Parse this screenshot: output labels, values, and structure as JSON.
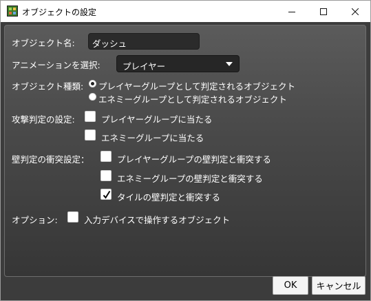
{
  "window": {
    "title": "オブジェクトの設定",
    "minimize_glyph": "─",
    "maximize_glyph": "☐",
    "close_glyph": "✕"
  },
  "object_name": {
    "label": "オブジェクト名:",
    "value": "ダッシュ"
  },
  "animation": {
    "label": "アニメーションを選択:",
    "selected": "プレイヤー"
  },
  "object_type": {
    "label": "オブジェクト種類:",
    "options": [
      {
        "label": "プレイヤーグループとして判定されるオブジェクト",
        "selected": true
      },
      {
        "label": "エネミーグループとして判定されるオブジェクト",
        "selected": false
      }
    ]
  },
  "attack": {
    "label": "攻撃判定の設定:",
    "options": [
      {
        "label": "プレイヤーグループに当たる",
        "checked": false
      },
      {
        "label": "エネミーグループに当たる",
        "checked": false
      }
    ]
  },
  "wall": {
    "label": "壁判定の衝突設定：",
    "options": [
      {
        "label": "プレイヤーグループの壁判定と衝突する",
        "checked": false
      },
      {
        "label": "エネミーグループの壁判定と衝突する",
        "checked": false
      },
      {
        "label": "タイルの壁判定と衝突する",
        "checked": true
      }
    ]
  },
  "options": {
    "label": "オプション:",
    "items": [
      {
        "label": "入力デバイスで操作するオブジェクト",
        "checked": false
      }
    ]
  },
  "buttons": {
    "ok": "OK",
    "cancel": "キャンセル"
  }
}
